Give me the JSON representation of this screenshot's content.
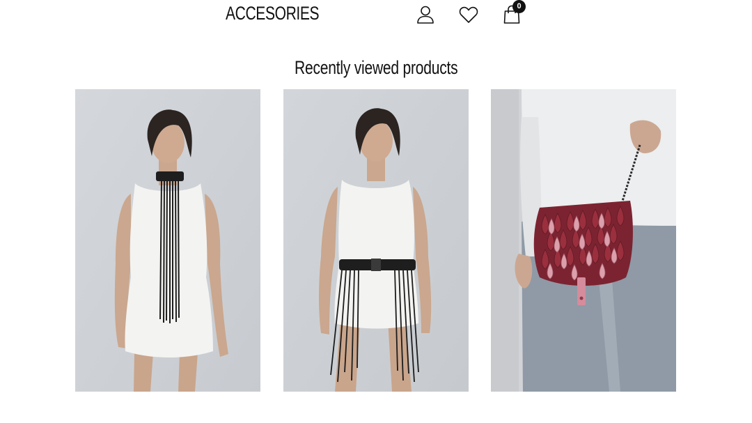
{
  "header": {
    "nav_label": "ACCESORIES",
    "icons": [
      "user-icon",
      "heart-icon",
      "shopping-bag-icon"
    ],
    "cart_count": "0"
  },
  "recently_viewed": {
    "title": "Recently viewed products",
    "products": [
      {
        "image": "model in white dress wearing black leather fringe choker"
      },
      {
        "image": "model in white dress wearing black leather fringe belt"
      },
      {
        "image": "person holding burgundy and pink leather scale crossbody bag"
      }
    ]
  },
  "colors": {
    "text": "#111111",
    "badge_bg": "#111111",
    "badge_text": "#ffffff",
    "background": "#ffffff"
  }
}
